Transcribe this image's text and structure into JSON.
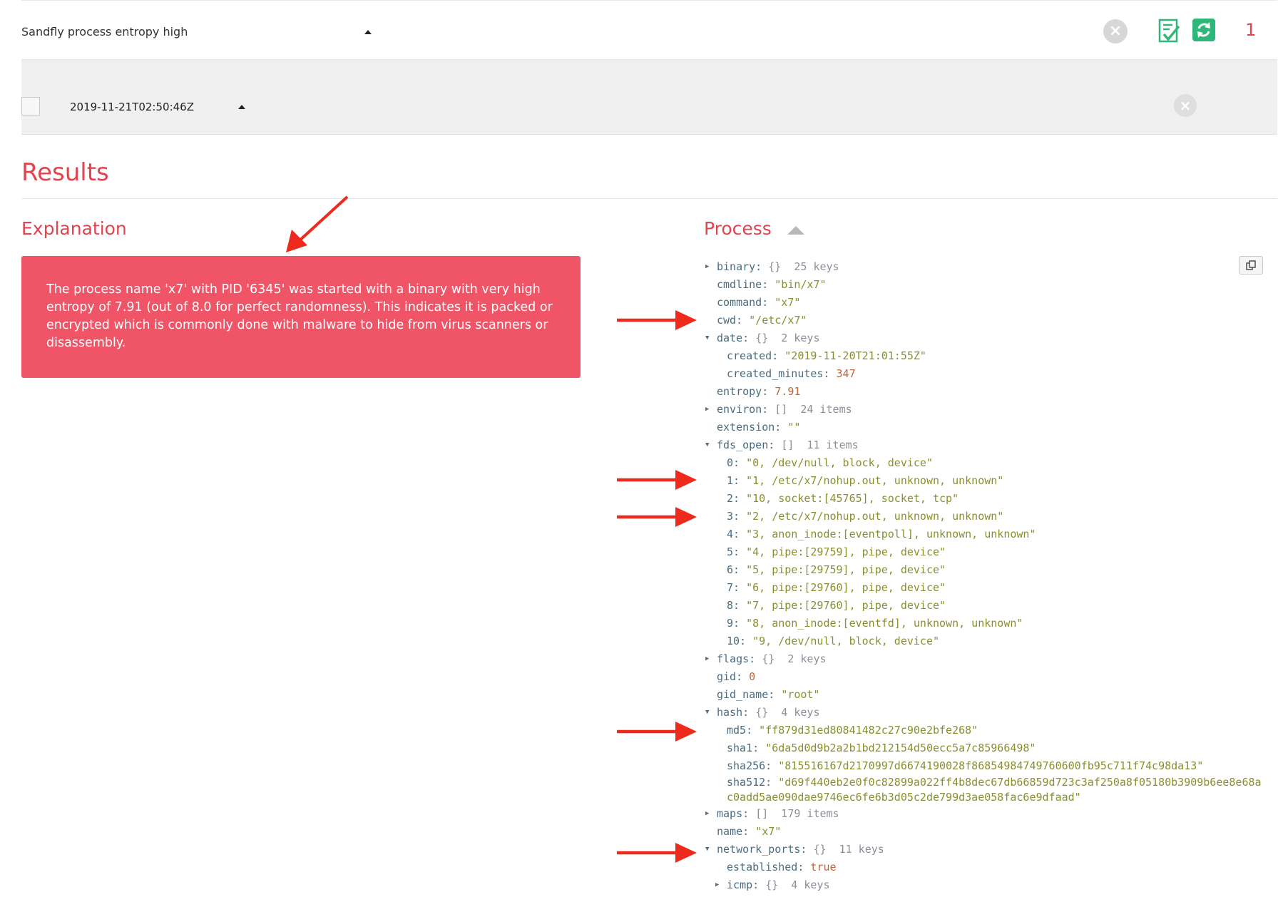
{
  "alert": {
    "name": "Sandfly process entropy high",
    "count": "1",
    "actions": [
      "dismiss-icon",
      "doc-check-icon",
      "refresh-icon"
    ]
  },
  "instance": {
    "timestamp": "2019-11-21T02:50:46Z"
  },
  "results": {
    "title": "Results",
    "explanation_title": "Explanation",
    "explanation_text": "The process name 'x7' with PID '6345' was started with a binary with very high entropy of 7.91 (out of 8.0 for perfect randomness). This indicates it is packed or encrypted which is commonly done with malware to hide from virus scanners or disassembly.",
    "process_title": "Process"
  },
  "colors": {
    "accent": "#e0444f",
    "explanation_bg": "#ef5566",
    "refresh_bg": "#2fb77a",
    "check_green": "#2fb77a",
    "annotation_arrow": "#ee2a1c"
  },
  "process_tree": [
    {
      "indent": 0,
      "toggle": "collapsed",
      "key": "binary",
      "meta": "{}  25 keys"
    },
    {
      "indent": 0,
      "key": "cmdline",
      "value": "\"bin/x7\"",
      "type": "string"
    },
    {
      "indent": 0,
      "key": "command",
      "value": "\"x7\"",
      "type": "string"
    },
    {
      "indent": 0,
      "key": "cwd",
      "value": "\"/etc/x7\"",
      "type": "string"
    },
    {
      "indent": 0,
      "toggle": "expanded",
      "key": "date",
      "meta": "{}  2 keys"
    },
    {
      "indent": 1,
      "key": "created",
      "value": "\"2019-11-20T21:01:55Z\"",
      "type": "string"
    },
    {
      "indent": 1,
      "key": "created_minutes",
      "value": "347",
      "type": "number"
    },
    {
      "indent": 0,
      "key": "entropy",
      "value": "7.91",
      "type": "number"
    },
    {
      "indent": 0,
      "toggle": "collapsed",
      "key": "environ",
      "meta": "[]  24 items"
    },
    {
      "indent": 0,
      "key": "extension",
      "value": "\"\"",
      "type": "string"
    },
    {
      "indent": 0,
      "toggle": "expanded",
      "key": "fds_open",
      "meta": "[]  11 items"
    },
    {
      "indent": 1,
      "key": "0",
      "value": "\"0, /dev/null, block, device\"",
      "type": "string"
    },
    {
      "indent": 1,
      "key": "1",
      "value": "\"1, /etc/x7/nohup.out, unknown, unknown\"",
      "type": "string"
    },
    {
      "indent": 1,
      "key": "2",
      "value": "\"10, socket:[45765], socket, tcp\"",
      "type": "string"
    },
    {
      "indent": 1,
      "key": "3",
      "value": "\"2, /etc/x7/nohup.out, unknown, unknown\"",
      "type": "string"
    },
    {
      "indent": 1,
      "key": "4",
      "value": "\"3, anon_inode:[eventpoll], unknown, unknown\"",
      "type": "string"
    },
    {
      "indent": 1,
      "key": "5",
      "value": "\"4, pipe:[29759], pipe, device\"",
      "type": "string"
    },
    {
      "indent": 1,
      "key": "6",
      "value": "\"5, pipe:[29759], pipe, device\"",
      "type": "string"
    },
    {
      "indent": 1,
      "key": "7",
      "value": "\"6, pipe:[29760], pipe, device\"",
      "type": "string"
    },
    {
      "indent": 1,
      "key": "8",
      "value": "\"7, pipe:[29760], pipe, device\"",
      "type": "string"
    },
    {
      "indent": 1,
      "key": "9",
      "value": "\"8, anon_inode:[eventfd], unknown, unknown\"",
      "type": "string"
    },
    {
      "indent": 1,
      "key": "10",
      "value": "\"9, /dev/null, block, device\"",
      "type": "string"
    },
    {
      "indent": 0,
      "toggle": "collapsed",
      "key": "flags",
      "meta": "{}  2 keys"
    },
    {
      "indent": 0,
      "key": "gid",
      "value": "0",
      "type": "number"
    },
    {
      "indent": 0,
      "key": "gid_name",
      "value": "\"root\"",
      "type": "string"
    },
    {
      "indent": 0,
      "toggle": "expanded",
      "key": "hash",
      "meta": "{}  4 keys"
    },
    {
      "indent": 1,
      "key": "md5",
      "value": "\"ff879d31ed80841482c27c90e2bfe268\"",
      "type": "string"
    },
    {
      "indent": 1,
      "key": "sha1",
      "value": "\"6da5d0d9b2a2b1bd212154d50ecc5a7c85966498\"",
      "type": "string"
    },
    {
      "indent": 1,
      "key": "sha256",
      "value": "\"815516167d2170997d6674190028f86854984749760600fb95c711f74c98da13\"",
      "type": "string"
    },
    {
      "indent": 1,
      "key": "sha512",
      "value": "\"d69f440eb2e0f0c82899a022ff4b8dec67db66859d723c3af250a8f05180b3909b6ee8e68ac0add5ae090dae9746ec6fe6b3d05c2de799d3ae058fac6e9dfaad\"",
      "type": "string",
      "wrap": true
    },
    {
      "indent": 0,
      "toggle": "collapsed",
      "key": "maps",
      "meta": "[]  179 items"
    },
    {
      "indent": 0,
      "key": "name",
      "value": "\"x7\"",
      "type": "string"
    },
    {
      "indent": 0,
      "toggle": "expanded",
      "key": "network_ports",
      "meta": "{}  11 keys"
    },
    {
      "indent": 1,
      "key": "established",
      "value": "true",
      "type": "number"
    },
    {
      "indent": 1,
      "toggle": "collapsed",
      "key": "icmp",
      "meta": "{}  4 keys"
    }
  ],
  "annotation_arrows": [
    {
      "target": "explanation-box"
    },
    {
      "target": "cwd"
    },
    {
      "target": "fds_open-1"
    },
    {
      "target": "fds_open-3"
    },
    {
      "target": "hash-md5"
    },
    {
      "target": "network_ports"
    }
  ]
}
